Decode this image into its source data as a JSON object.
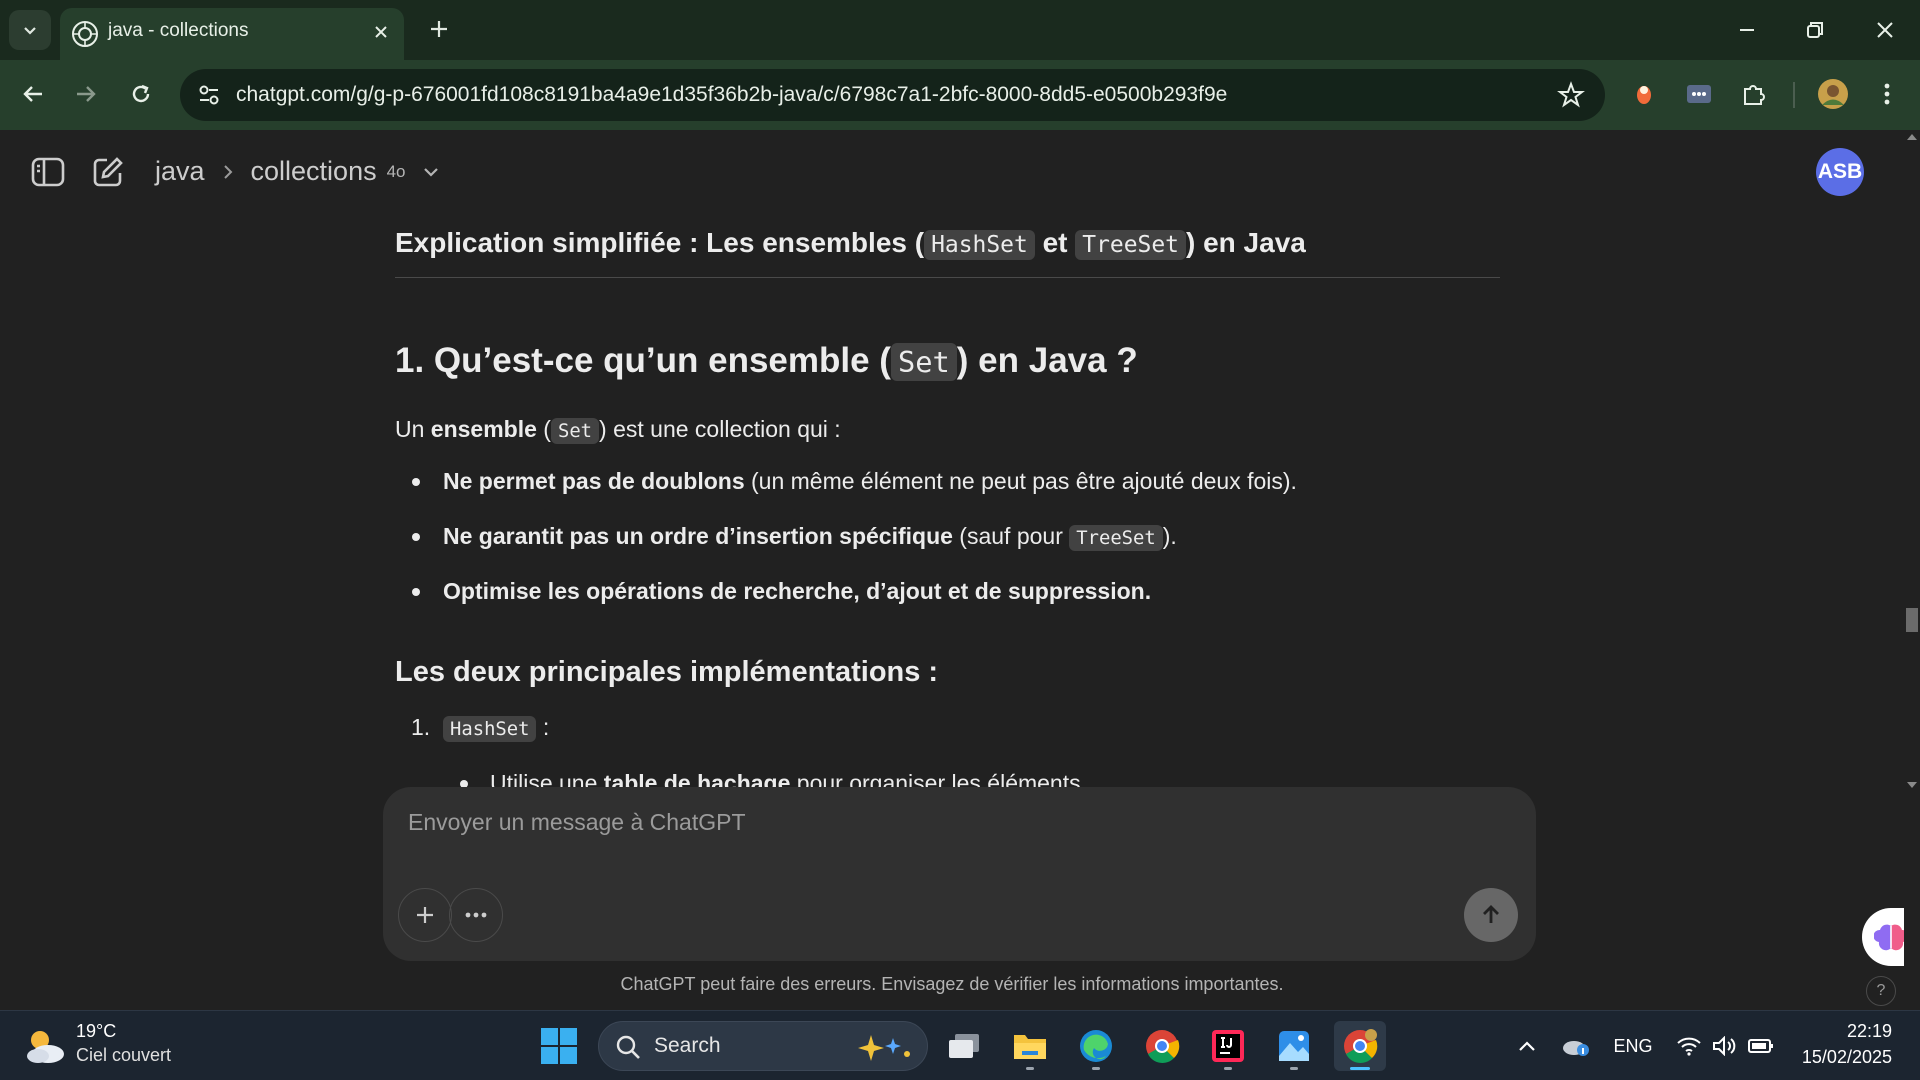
{
  "browser": {
    "tab_title": "java - collections",
    "url": "chatgpt.com/g/g-p-676001fd108c8191ba4a9e1d35f36b2b-java/c/6798c7a1-2bfc-8000-8dd5-e0500b293f9e",
    "icons": [
      "tab-search-icon",
      "chatgpt-favicon",
      "close-icon",
      "plus-icon",
      "minimize-icon",
      "restore-icon",
      "close-window-icon",
      "back-icon",
      "forward-icon",
      "reload-icon",
      "site-info-icon",
      "bookmark-star-icon",
      "extension-icon",
      "puzzle-icon",
      "profile-icon",
      "menu-icon"
    ]
  },
  "chatgpt": {
    "breadcrumb_project": "java",
    "breadcrumb_chat": "collections",
    "model_badge": "4o",
    "avatar_initials": "ASB",
    "avatar_color": "#5b6ee6"
  },
  "message": {
    "heading_prefix": "Explication simplifiée : Les ensembles (",
    "heading_code1": "HashSet",
    "heading_mid": " et ",
    "heading_code2": "TreeSet",
    "heading_suffix": ") en Java",
    "section_title_prefix": "1. Qu’est-ce qu’un ensemble (",
    "section_title_code": "Set",
    "section_title_suffix": ") en Java ?",
    "intro_prefix": "Un ",
    "intro_bold": "ensemble",
    "intro_mid": " (",
    "intro_code": "Set",
    "intro_suffix": ") est une collection qui :",
    "bullets": [
      {
        "bold": "Ne permet pas de doublons",
        "rest": " (un même élément ne peut pas être ajouté deux fois)."
      },
      {
        "bold": "Ne garantit pas un ordre d’insertion spécifique",
        "rest_before": " (sauf pour ",
        "code": "TreeSet",
        "rest_after": ")."
      },
      {
        "bold": "Optimise les opérations de recherche, d’ajout et de suppression."
      }
    ],
    "subheading": "Les deux principales implémentations :",
    "ordered_number": "1.",
    "ordered_code": "HashSet",
    "ordered_suffix": " :",
    "sub_bullet_prefix": "Utilise une ",
    "sub_bullet_bold": "table de hachage",
    "sub_bullet_suffix": " pour organiser les éléments."
  },
  "composer": {
    "placeholder": "Envoyer un message à ChatGPT",
    "disclaimer": "ChatGPT peut faire des erreurs. Envisagez de vérifier les informations importantes.",
    "help_label": "?"
  },
  "taskbar": {
    "weather_temp": "19°C",
    "weather_desc": "Ciel couvert",
    "search_label": "Search",
    "language": "ENG",
    "time": "22:19",
    "date": "15/02/2025",
    "accent_color": "#4cc2ff"
  }
}
